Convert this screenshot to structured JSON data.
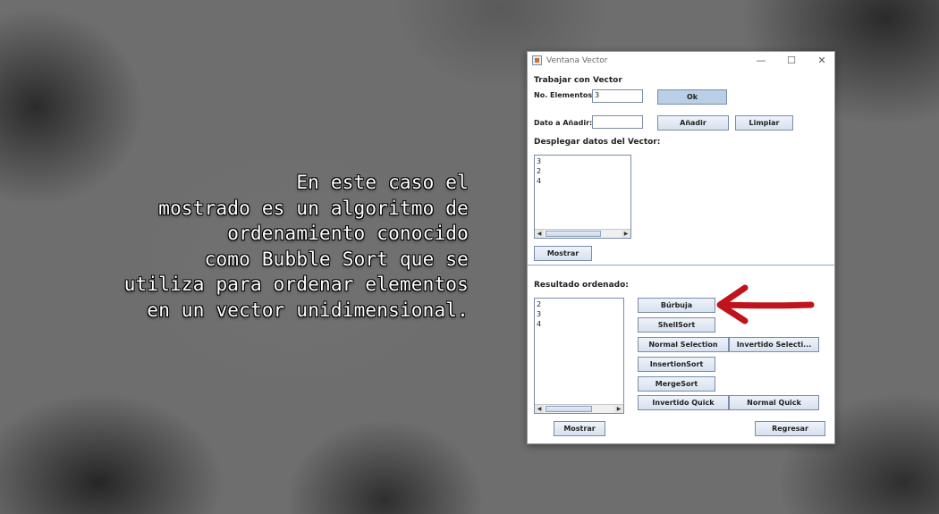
{
  "caption": {
    "lines": [
      "En este caso el",
      "mostrado es un algoritmo de",
      "ordenamiento conocido",
      "como Bubble Sort que se",
      "utiliza para ordenar elementos",
      "en un vector unidimensional."
    ]
  },
  "window": {
    "title": "Ventana Vector",
    "controls": {
      "minimize": "—",
      "maximize": "☐",
      "close": "✕"
    }
  },
  "form": {
    "section_title": "Trabajar con Vector",
    "num_elements_label": "No. Elementos:",
    "num_elements_value": "3",
    "ok_button": "Ok",
    "add_data_label": "Dato a Añadir:",
    "add_data_value": "",
    "add_button": "Añadir",
    "clear_button": "Limpiar",
    "display_title": "Desplegar datos del Vector:",
    "vector_items": [
      "3",
      "2",
      "4"
    ],
    "show_button_top": "Mostrar",
    "result_title": "Resultado ordenado:",
    "result_items": [
      "2",
      "3",
      "4"
    ],
    "show_button_bottom": "Mostrar",
    "back_button": "Regresar"
  },
  "sort_buttons": {
    "bubble": "Búrbuja",
    "shell": "ShellSort",
    "normal_selection": "Normal Selection",
    "inverted_selection": "Invertido Selecti...",
    "insertion": "InsertionSort",
    "merge": "MergeSort",
    "inverted_quick": "Invertido Quick",
    "normal_quick": "Normal Quick"
  },
  "colors": {
    "annotation_arrow": "#c0141c",
    "button_border": "#7a8ca8",
    "button_fill": "#dbe5f1"
  }
}
